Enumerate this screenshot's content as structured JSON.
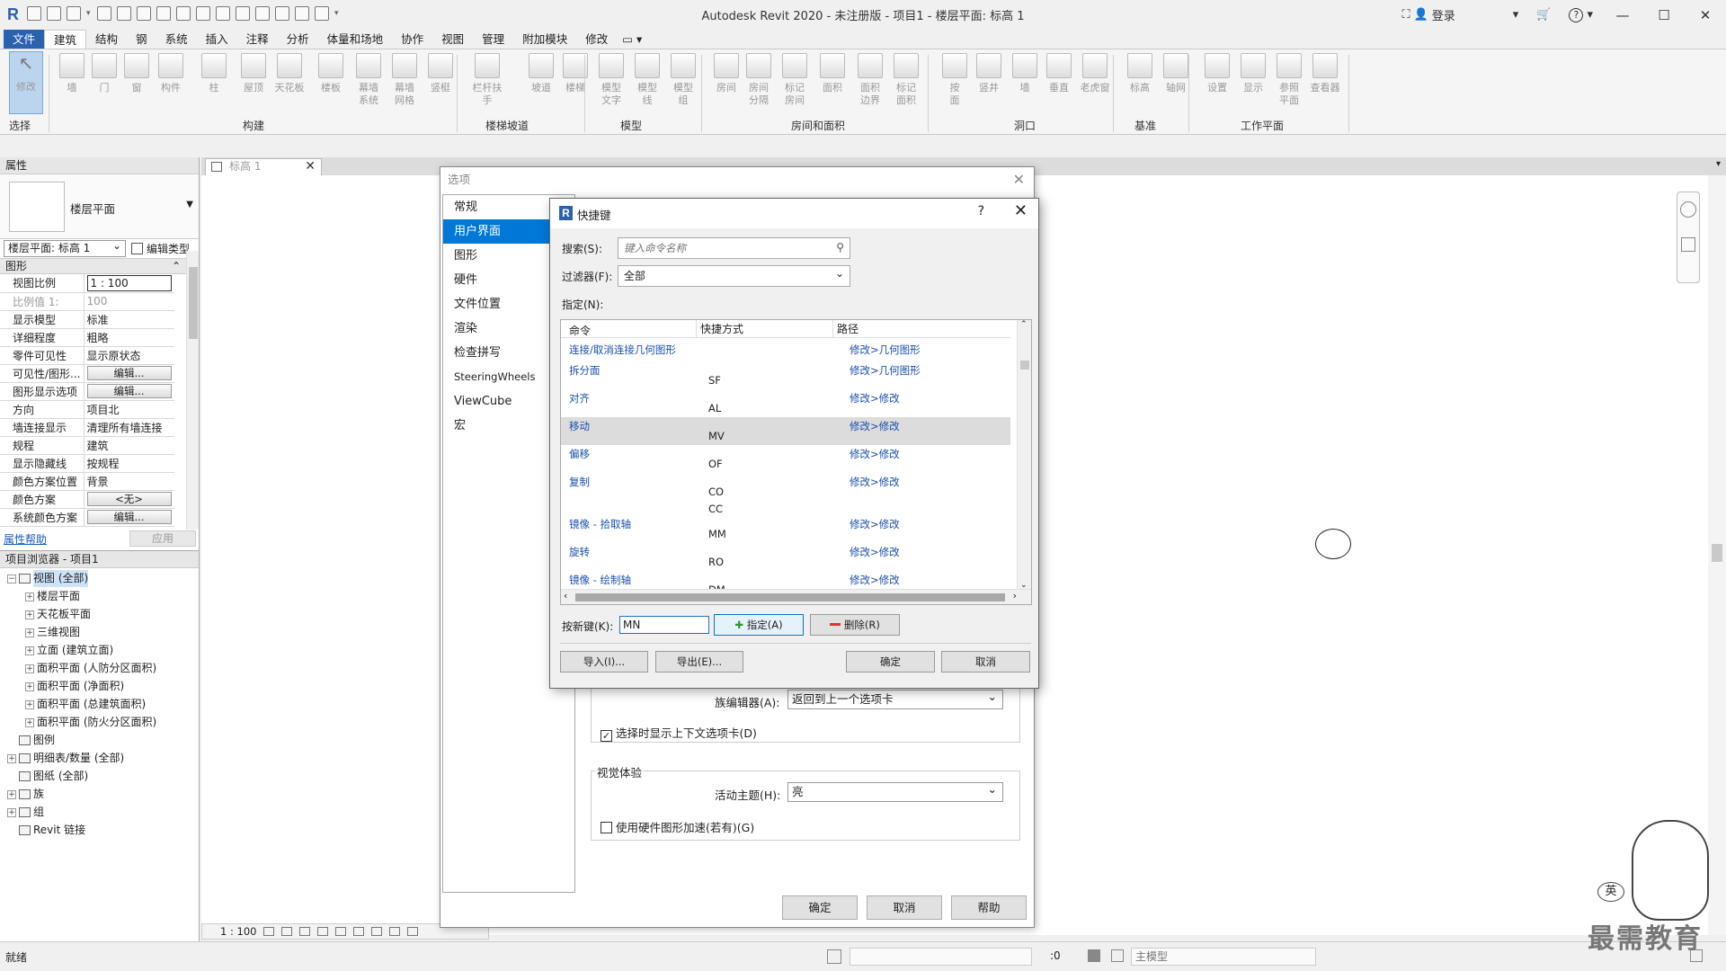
{
  "titlebar": {
    "title": "Autodesk Revit 2020 - 未注册版 - 项目1 - 楼层平面: 标高 1",
    "login": "登录",
    "help": "?"
  },
  "ribbon_tabs": [
    "文件",
    "建筑",
    "结构",
    "钢",
    "系统",
    "插入",
    "注释",
    "分析",
    "体量和场地",
    "协作",
    "视图",
    "管理",
    "附加模块",
    "修改"
  ],
  "ribbon": {
    "tools": [
      {
        "label": "修改"
      },
      {
        "label": "墙"
      },
      {
        "label": "门"
      },
      {
        "label": "窗"
      },
      {
        "label": "构件"
      },
      {
        "label": "柱"
      },
      {
        "label": "屋顶"
      },
      {
        "label": "天花板"
      },
      {
        "label": "楼板"
      },
      {
        "label": "幕墙\n系统"
      },
      {
        "label": "幕墙\n网格"
      },
      {
        "label": "竖梃"
      },
      {
        "label": "栏杆扶手"
      },
      {
        "label": "坡道"
      },
      {
        "label": "楼梯"
      },
      {
        "label": "模型\n文字"
      },
      {
        "label": "模型\n线"
      },
      {
        "label": "模型\n组"
      },
      {
        "label": "房间"
      },
      {
        "label": "房间\n分隔"
      },
      {
        "label": "标记\n房间"
      },
      {
        "label": "面积"
      },
      {
        "label": "面积\n边界"
      },
      {
        "label": "标记\n面积"
      },
      {
        "label": "按\n面"
      },
      {
        "label": "竖井"
      },
      {
        "label": "墙"
      },
      {
        "label": "垂直"
      },
      {
        "label": "老虎窗"
      },
      {
        "label": "标高"
      },
      {
        "label": "轴网"
      },
      {
        "label": "设置"
      },
      {
        "label": "显示"
      },
      {
        "label": "参照\n平面"
      },
      {
        "label": "查看器"
      }
    ],
    "panels": [
      "选择",
      "构建",
      "楼梯坡道",
      "模型",
      "房间和面积",
      "洞口",
      "基准",
      "工作平面"
    ]
  },
  "properties": {
    "title": "属性",
    "type_name": "楼层平面",
    "instance_selector": "楼层平面: 标高 1",
    "edit_type": "编辑类型",
    "group": "图形",
    "rows": [
      {
        "k": "视图比例",
        "v": "1 : 100",
        "style": "box"
      },
      {
        "k": "比例值 1:",
        "v": "100",
        "style": "dim"
      },
      {
        "k": "显示模型",
        "v": "标准"
      },
      {
        "k": "详细程度",
        "v": "粗略"
      },
      {
        "k": "零件可见性",
        "v": "显示原状态"
      },
      {
        "k": "可见性/图形...",
        "v": "编辑...",
        "style": "btn"
      },
      {
        "k": "图形显示选项",
        "v": "编辑...",
        "style": "btn"
      },
      {
        "k": "方向",
        "v": "项目北"
      },
      {
        "k": "墙连接显示",
        "v": "清理所有墙连接"
      },
      {
        "k": "规程",
        "v": "建筑"
      },
      {
        "k": "显示隐藏线",
        "v": "按规程"
      },
      {
        "k": "颜色方案位置",
        "v": "背景"
      },
      {
        "k": "颜色方案",
        "v": "<无>",
        "style": "btn"
      },
      {
        "k": "系统颜色方案",
        "v": "编辑...",
        "style": "btn"
      }
    ],
    "help": "属性帮助",
    "apply": "应用"
  },
  "browser": {
    "title": "项目浏览器 - 项目1",
    "items": [
      {
        "label": "视图 (全部)",
        "exp": "−",
        "indent": 0,
        "icon": true,
        "sel": true
      },
      {
        "label": "楼层平面",
        "exp": "+",
        "indent": 1
      },
      {
        "label": "天花板平面",
        "exp": "+",
        "indent": 1
      },
      {
        "label": "三维视图",
        "exp": "+",
        "indent": 1
      },
      {
        "label": "立面 (建筑立面)",
        "exp": "+",
        "indent": 1
      },
      {
        "label": "面积平面 (人防分区面积)",
        "exp": "+",
        "indent": 1
      },
      {
        "label": "面积平面 (净面积)",
        "exp": "+",
        "indent": 1
      },
      {
        "label": "面积平面 (总建筑面积)",
        "exp": "+",
        "indent": 1
      },
      {
        "label": "面积平面 (防火分区面积)",
        "exp": "+",
        "indent": 1
      },
      {
        "label": "图例",
        "exp": "",
        "indent": 0,
        "icon": true
      },
      {
        "label": "明细表/数量 (全部)",
        "exp": "+",
        "indent": 0,
        "icon": true
      },
      {
        "label": "图纸 (全部)",
        "exp": "",
        "indent": 0,
        "icon": true
      },
      {
        "label": "族",
        "exp": "+",
        "indent": 0,
        "icon": true
      },
      {
        "label": "组",
        "exp": "+",
        "indent": 0,
        "icon": true
      },
      {
        "label": "Revit 链接",
        "exp": "",
        "indent": 0,
        "icon": true
      }
    ]
  },
  "view_tab": {
    "label": "标高 1"
  },
  "view_control": {
    "scale": "1 : 100"
  },
  "statusbar": {
    "status": "就绪",
    "zero": ":0",
    "model": "主模型"
  },
  "options_dialog": {
    "title": "选项",
    "nav": [
      "常规",
      "用户界面",
      "图形",
      "硬件",
      "文件位置",
      "渲染",
      "检查拼写",
      "SteeringWheels",
      "ViewCube",
      "宏"
    ],
    "family_editor_label": "族编辑器(A):",
    "family_editor_value": "返回到上一个选项卡",
    "context_tab_check": "选择时显示上下文选项卡(D)",
    "visual_group": "视觉体验",
    "theme_label": "活动主题(H):",
    "theme_value": "亮",
    "hw_accel": "使用硬件图形加速(若有)(G)",
    "ok": "确定",
    "cancel": "取消",
    "help": "帮助"
  },
  "shortcut_dialog": {
    "title": "快捷键",
    "help": "?",
    "search_label": "搜索(S):",
    "search_placeholder": "键入命令名称",
    "filter_label": "过滤器(F):",
    "filter_value": "全部",
    "assign_label": "指定(N):",
    "columns": [
      "命令",
      "快捷方式",
      "路径"
    ],
    "rows": [
      {
        "cmd": "连接/取消连接几何图形",
        "keys": "",
        "path": "修改>几何图形"
      },
      {
        "cmd": "拆分面",
        "keys": "SF",
        "path": "修改>几何图形"
      },
      {
        "cmd": "对齐",
        "keys": "AL",
        "path": "修改>修改"
      },
      {
        "cmd": "移动",
        "keys": "MV",
        "path": "修改>修改"
      },
      {
        "cmd": "偏移",
        "keys": "OF",
        "path": "修改>修改"
      },
      {
        "cmd": "复制",
        "keys": "CO\nCC",
        "path": "修改>修改"
      },
      {
        "cmd": "镜像 - 拾取轴",
        "keys": "MM",
        "path": "修改>修改"
      },
      {
        "cmd": "旋转",
        "keys": "RO",
        "path": "修改>修改"
      },
      {
        "cmd": "镜像 - 绘制轴",
        "keys": "DM",
        "path": "修改>修改"
      }
    ],
    "selected_row": 3,
    "new_key_label": "按新键(K):",
    "new_key_value": "MN",
    "assign_btn": "指定(A)",
    "delete_btn": "删除(R)",
    "import_btn": "导入(I)...",
    "export_btn": "导出(E)...",
    "ok": "确定",
    "cancel": "取消"
  },
  "watermark": {
    "text": "最需教育",
    "ime": "英"
  }
}
